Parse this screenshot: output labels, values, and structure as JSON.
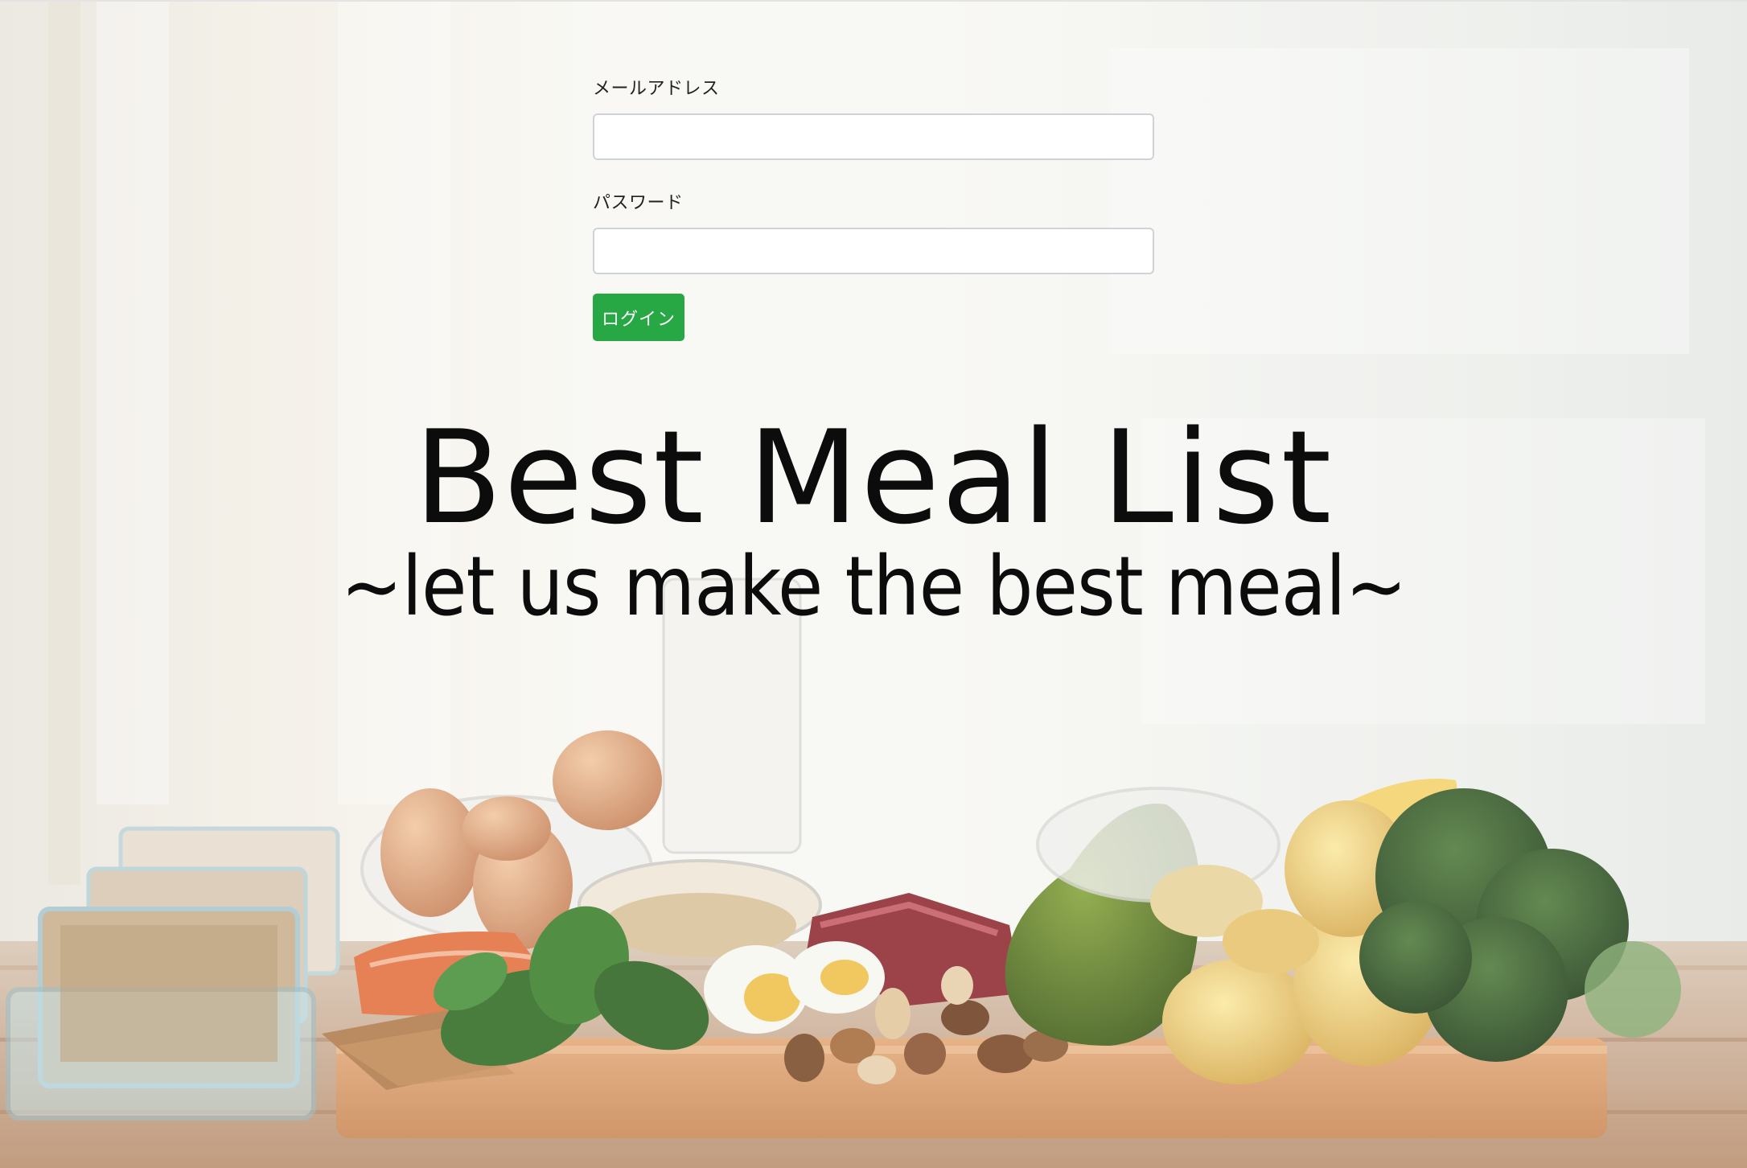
{
  "form": {
    "email_label": "メールアドレス",
    "email_value": "",
    "password_label": "パスワード",
    "password_value": "",
    "login_label": "ログイン"
  },
  "hero": {
    "title": "Best Meal List",
    "subtitle": "~let us make the best meal~"
  },
  "colors": {
    "button": "#28a745",
    "text": "#0c0c0c"
  }
}
